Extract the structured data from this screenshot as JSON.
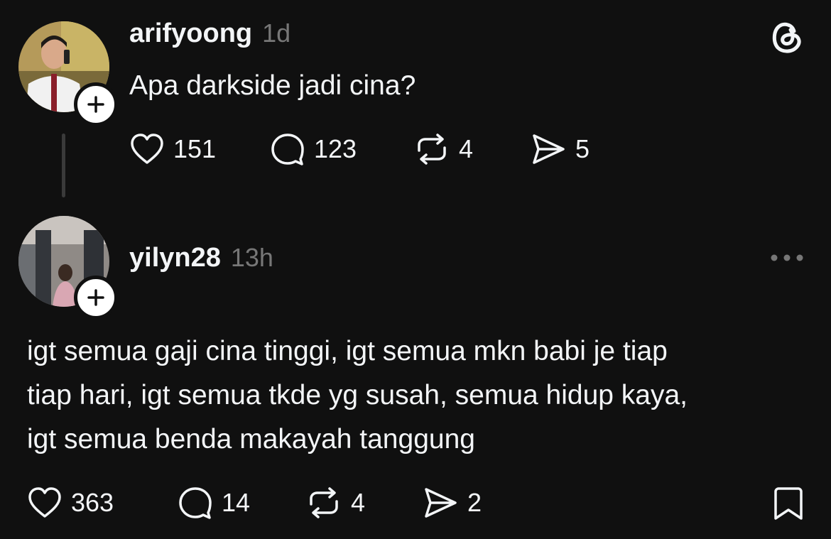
{
  "posts": [
    {
      "username": "arifyoong",
      "time": "1d",
      "text": "Apa darkside jadi cina?",
      "stats": {
        "likes": "151",
        "replies": "123",
        "reposts": "4",
        "shares": "5"
      },
      "icons": {
        "avatar": "user-avatar",
        "follow": "plus-icon",
        "corner": "threads-logo-icon"
      }
    },
    {
      "username": "yilyn28",
      "time": "13h",
      "text_lines": [
        "igt semua gaji cina tinggi, igt semua mkn babi je tiap",
        "tiap hari, igt semua tkde yg susah, semua hidup kaya,",
        "igt semua benda makayah tanggung"
      ],
      "stats": {
        "likes": "363",
        "replies": "14",
        "reposts": "4",
        "shares": "2"
      },
      "icons": {
        "avatar": "user-avatar",
        "follow": "plus-icon",
        "corner": "more-icon",
        "save": "bookmark-icon"
      }
    }
  ],
  "colors": {
    "background": "#101010",
    "text": "#f3f5f7",
    "muted": "#777777",
    "thread_line": "#3a3a3a"
  }
}
